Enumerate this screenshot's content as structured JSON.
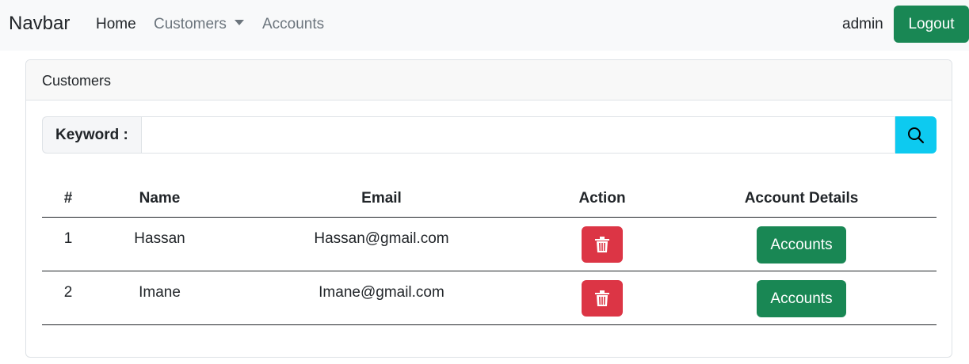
{
  "navbar": {
    "brand": "Navbar",
    "links": [
      {
        "label": "Home"
      },
      {
        "label": "Customers"
      },
      {
        "label": "Accounts"
      }
    ],
    "username": "admin",
    "logout_label": "Logout"
  },
  "card": {
    "title": "Customers",
    "search": {
      "label": "Keyword :",
      "value": "",
      "placeholder": "",
      "button_icon": "search-icon"
    },
    "table": {
      "columns": [
        "#",
        "Name",
        "Email",
        "Action",
        "Account Details"
      ],
      "rows": [
        {
          "id": "1",
          "name": "Hassan",
          "email": "Hassan@gmail.com",
          "action_icon": "trash-icon",
          "details_label": "Accounts"
        },
        {
          "id": "2",
          "name": "Imane",
          "email": "Imane@gmail.com",
          "action_icon": "trash-icon",
          "details_label": "Accounts"
        }
      ]
    }
  },
  "colors": {
    "navbar_bg": "#f8f9fa",
    "success": "#198754",
    "danger": "#dc3545",
    "info": "#0dcaf0"
  }
}
